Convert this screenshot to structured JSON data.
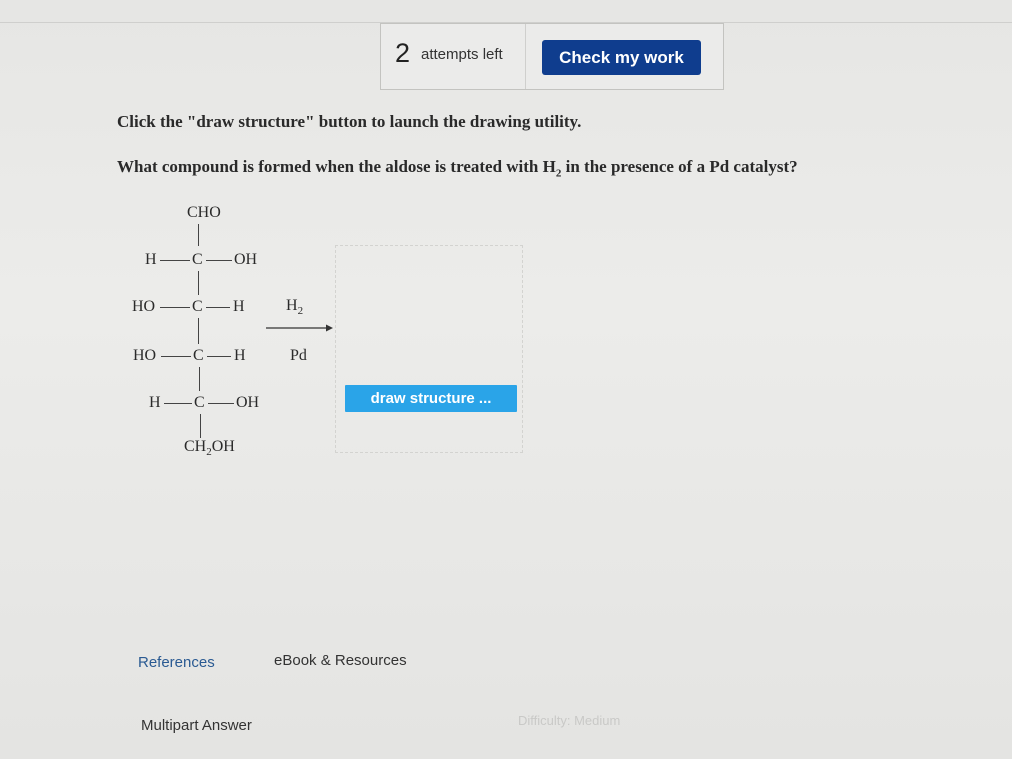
{
  "header": {
    "attempts_count": "2",
    "attempts_label": "attempts left",
    "check_button": "Check my work"
  },
  "prompt": {
    "instruction": "Click the \"draw structure\" button to launch the drawing utility.",
    "question_pre": "What compound is formed when the aldose is treated with H",
    "question_sub": "2",
    "question_post": " in the presence of a Pd catalyst?"
  },
  "structure": {
    "top": "CHO",
    "row1_left": "H",
    "row1_c": "C",
    "row1_right": "OH",
    "row2_left": "HO",
    "row2_c": "C",
    "row2_right": "H",
    "row3_left": "HO",
    "row3_c": "C",
    "row3_right": "H",
    "row4_left": "H",
    "row4_c": "C",
    "row4_right": "OH",
    "bottom_pre": "CH",
    "bottom_sub": "2",
    "bottom_post": "OH"
  },
  "reaction": {
    "reagent_pre": "H",
    "reagent_sub": "2",
    "catalyst": "Pd"
  },
  "draw_button": "draw structure ...",
  "footer": {
    "references": "References",
    "ebook": "eBook & Resources",
    "multipart": "Multipart Answer",
    "difficulty": "Difficulty: Medium"
  }
}
